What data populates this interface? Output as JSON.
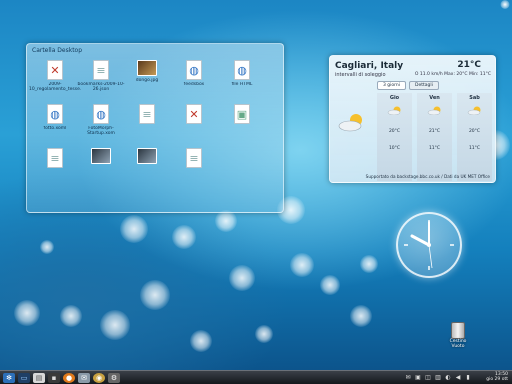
{
  "folder": {
    "title": "Cartella Desktop",
    "items": [
      {
        "label": "2009-10_regolamento_tesse.pdf",
        "icon": "pdf-icon"
      },
      {
        "label": "bookmarks-2009-10-26.json",
        "icon": "text-file-icon"
      },
      {
        "label": "dongo.jpg",
        "icon": "image-icon"
      },
      {
        "label": "feedsbox",
        "icon": "html-file-icon"
      },
      {
        "label": "file HTML",
        "icon": "html-file-icon"
      },
      {
        "label": "fotto.xoml",
        "icon": "html-file-icon"
      },
      {
        "label": "FotoMorph-Startup.xom",
        "icon": "html-file-icon"
      },
      {
        "label": "",
        "icon": "text-file-icon"
      },
      {
        "label": "",
        "icon": "pdf-icon"
      },
      {
        "label": "",
        "icon": "image-file-icon"
      },
      {
        "label": "",
        "icon": "text-file-icon"
      },
      {
        "label": "",
        "icon": "image-icon"
      },
      {
        "label": "",
        "icon": "image-icon"
      },
      {
        "label": "",
        "icon": "text-file-icon"
      }
    ]
  },
  "weather": {
    "city": "Cagliari, Italy",
    "condition": "intervalli di soleggio",
    "temperature": "21°C",
    "wind": "O 11.0 km/h",
    "range": "Max: 20°C Min: 11°C",
    "tab_days": "3 giorni",
    "tab_details": "Dettagli",
    "days": [
      {
        "name": "Gio",
        "high": "20°C",
        "low": "10°C"
      },
      {
        "name": "Ven",
        "high": "21°C",
        "low": "11°C"
      },
      {
        "name": "Sab",
        "high": "20°C",
        "low": "11°C"
      }
    ],
    "source": "Supportato da backstage.bbc.co.uk / Dati da UK MET Office"
  },
  "trash": {
    "label": "Cestino Vuoto"
  },
  "taskbar": {
    "time": "13:50",
    "date": "gio 29 ott"
  },
  "colors": {
    "accent": "#1c86c4",
    "panel": "#14181c"
  }
}
